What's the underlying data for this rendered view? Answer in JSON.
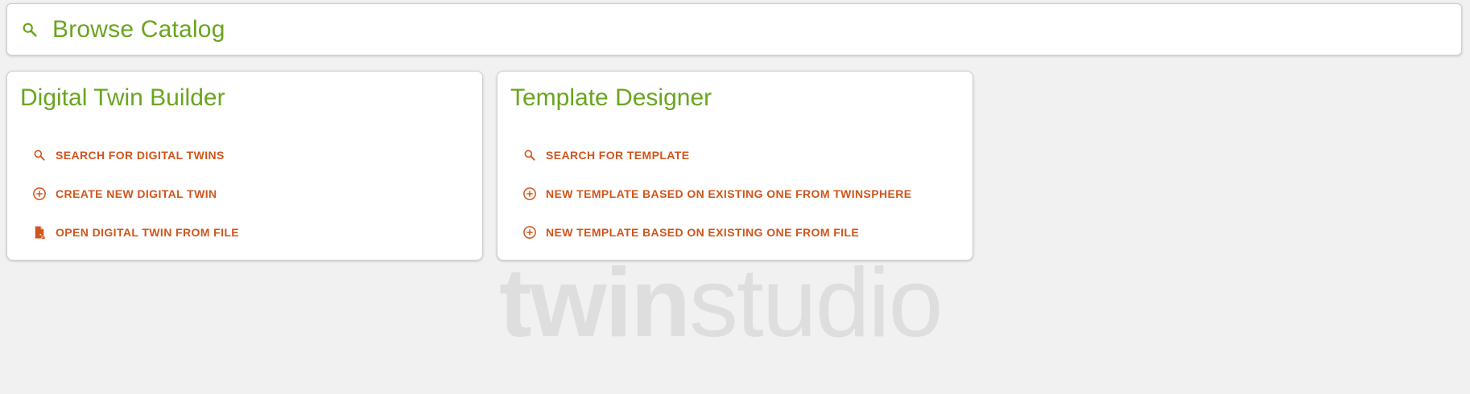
{
  "search": {
    "label": "Browse Catalog",
    "icon": "search-icon"
  },
  "cards": {
    "builder": {
      "title": "Digital Twin Builder",
      "actions": [
        {
          "label": "SEARCH FOR DIGITAL TWINS",
          "icon": "search-icon"
        },
        {
          "label": "CREATE NEW DIGITAL TWIN",
          "icon": "add-circle-icon"
        },
        {
          "label": "OPEN DIGITAL TWIN FROM FILE",
          "icon": "file-open-icon"
        }
      ]
    },
    "designer": {
      "title": "Template Designer",
      "actions": [
        {
          "label": "SEARCH FOR TEMPLATE",
          "icon": "search-icon"
        },
        {
          "label": "NEW TEMPLATE BASED ON EXISTING ONE FROM TWINSPHERE",
          "icon": "add-circle-icon"
        },
        {
          "label": "NEW TEMPLATE BASED ON EXISTING ONE FROM FILE",
          "icon": "add-circle-icon"
        }
      ]
    }
  },
  "watermark": {
    "bold": "twin",
    "light": "studio"
  },
  "colors": {
    "background": "#f1f1f1",
    "accent_green": "#6aa51f",
    "action_orange": "#d0551b",
    "watermark_gray": "#dedede"
  }
}
